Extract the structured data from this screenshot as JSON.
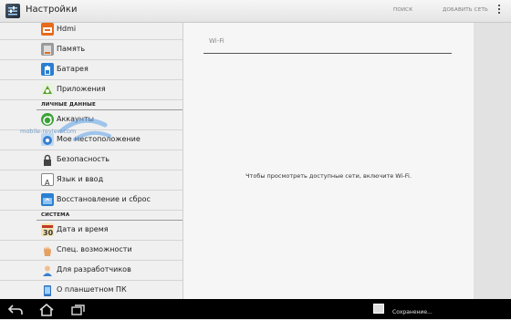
{
  "actionbar": {
    "title": "Настройки",
    "search_label": "ПОИСК",
    "add_network_label": "ДОБАВИТЬ СЕТЬ"
  },
  "sidebar": {
    "items": [
      {
        "label": "Hdmi",
        "icon": "hdmi-icon",
        "color": "#e86a1a"
      },
      {
        "label": "Память",
        "icon": "storage-icon",
        "color": "#8a8a8a"
      },
      {
        "label": "Батарея",
        "icon": "battery-icon",
        "color": "#2a7fd1"
      },
      {
        "label": "Приложения",
        "icon": "apps-icon",
        "color": "#5aa02c"
      }
    ],
    "section_personal": "ЛИЧНЫЕ ДАННЫЕ",
    "personal_items": [
      {
        "label": "Аккаунты",
        "icon": "sync-icon",
        "color": "#3aa335"
      },
      {
        "label": "Мое местоположение",
        "icon": "location-icon",
        "color": "#3a7fd0"
      },
      {
        "label": "Безопасность",
        "icon": "lock-icon",
        "color": "#555555"
      },
      {
        "label": "Язык и ввод",
        "icon": "keyboard-icon",
        "color": "#ffffff"
      },
      {
        "label": "Восстановление и сброс",
        "icon": "backup-icon",
        "color": "#2a7fd1"
      }
    ],
    "section_system": "СИСТЕМА",
    "system_items": [
      {
        "label": "Дата и время",
        "icon": "calendar-icon",
        "color": "#d9a020"
      },
      {
        "label": "Спец. возможности",
        "icon": "hand-icon",
        "color": "#e09040"
      },
      {
        "label": "Для разработчиков",
        "icon": "developer-icon",
        "color": "#3a7fd0"
      },
      {
        "label": "О планшетном ПК",
        "icon": "tablet-icon",
        "color": "#2a6fc1"
      }
    ]
  },
  "detail": {
    "title": "Wi-Fi",
    "message": "Чтобы просмотреть доступные сети, включите Wi-Fi."
  },
  "watermark": "mobile-review.com",
  "statusbar": {
    "notification_text": "Сохранение..."
  }
}
